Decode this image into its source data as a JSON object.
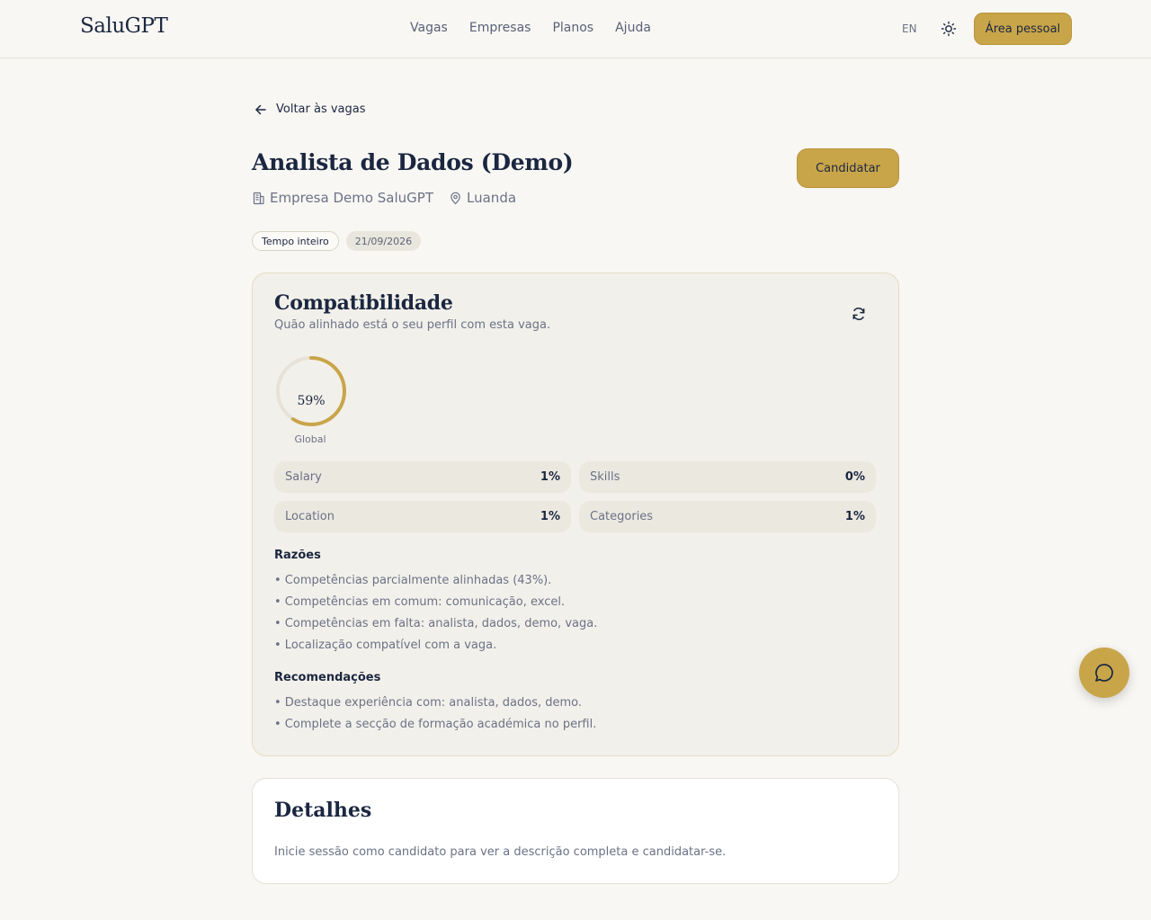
{
  "header": {
    "logo": "SaluGPT",
    "nav": [
      "Vagas",
      "Empresas",
      "Planos",
      "Ajuda"
    ],
    "lang": "EN",
    "personal_area": "Área pessoal"
  },
  "back_link": "Voltar às vagas",
  "job": {
    "title": "Analista de Dados (Demo)",
    "company": "Empresa Demo SaluGPT",
    "location": "Luanda",
    "apply_label": "Candidatar",
    "badges": [
      "Tempo inteiro",
      "21/09/2026"
    ]
  },
  "compat": {
    "title": "Compatibilidade",
    "subtitle": "Quão alinhado está o seu perfil com esta vaga.",
    "global_value": "59%",
    "global_fraction": 0.59,
    "global_label": "Global",
    "metrics": [
      {
        "name": "Salary",
        "value": "1%"
      },
      {
        "name": "Skills",
        "value": "0%"
      },
      {
        "name": "Location",
        "value": "1%"
      },
      {
        "name": "Categories",
        "value": "1%"
      }
    ],
    "reasons_title": "Razões",
    "reasons": [
      "• Competências parcialmente alinhadas (43%).",
      "• Competências em comum: comunicação, excel.",
      "• Competências em falta: analista, dados, demo, vaga.",
      "• Localização compatível com a vaga."
    ],
    "recommendations_title": "Recomendações",
    "recommendations": [
      "• Destaque experiência com: analista, dados, demo.",
      "• Complete a secção de formação académica no perfil."
    ]
  },
  "details": {
    "title": "Detalhes",
    "text": "Inicie sessão como candidato para ver a descrição completa e candidatar-se."
  },
  "colors": {
    "accent": "#c9a54a",
    "text": "#1b2740",
    "muted": "#6b7286",
    "background": "#f8f7f3"
  },
  "icons": [
    "sun-icon",
    "arrow-left-icon",
    "building-icon",
    "map-pin-icon",
    "refresh-icon",
    "chat-icon"
  ]
}
